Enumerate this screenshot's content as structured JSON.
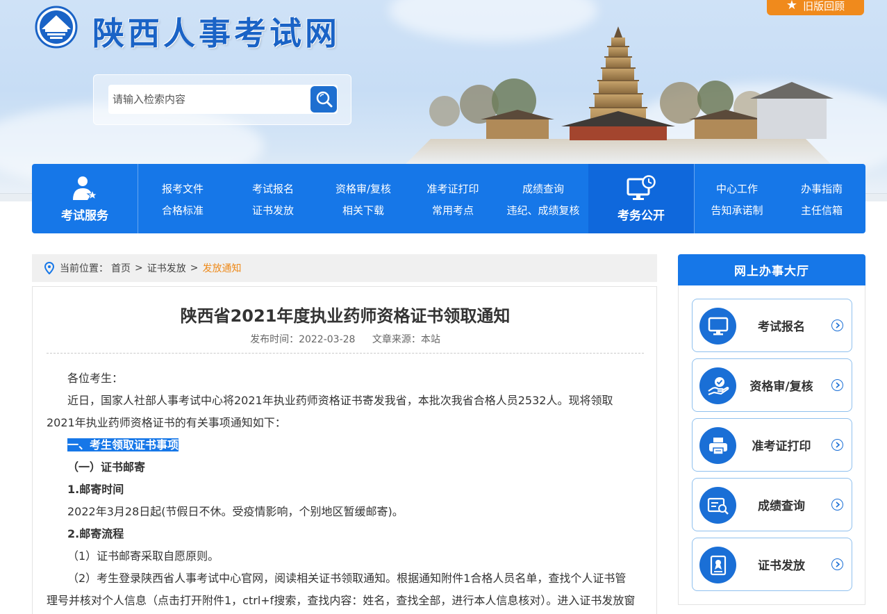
{
  "header": {
    "site_title": "陕西人事考试网",
    "old_version_label": "旧版回顾",
    "search_placeholder": "请输入检索内容"
  },
  "nav": {
    "exam_service_label": "考试服务",
    "exam_public_label": "考务公开",
    "links_row1": [
      "报考文件",
      "考试报名",
      "资格审/复核",
      "准考证打印",
      "成绩查询"
    ],
    "links_row2": [
      "合格标准",
      "证书发放",
      "相关下载",
      "常用考点",
      "违纪、成绩复核"
    ],
    "right_row1": [
      "中心工作",
      "办事指南"
    ],
    "right_row2": [
      "告知承诺制",
      "主任信箱"
    ]
  },
  "breadcrumb": {
    "prefix": "当前位置：",
    "home": "首页",
    "section": "证书发放",
    "current": "发放通知",
    "separator": ">"
  },
  "article": {
    "title": "陕西省2021年度执业药师资格证书领取通知",
    "publish_time": "发布时间：2022-03-28",
    "source": "文章来源：本站",
    "paragraphs": [
      "各位考生：",
      "近日，国家人社部人事考试中心将2021年执业药师资格证书寄发我省，本批次我省合格人员2532人。现将领取2021年执业药师资格证书的有关事项通知如下：",
      "一、考生领取证书事项",
      "（一）证书邮寄",
      "1.邮寄时间",
      "2022年3月28日起(节假日不休。受疫情影响，个别地区暂缓邮寄)。",
      "2.邮寄流程",
      "（1）证书邮寄采取自愿原则。",
      "（2）考生登录陕西省人事考试中心官网，阅读相关证书领取通知。根据通知附件1合格人员名单，查找个人证书管理号并核对个人信息（点击打开附件1，ctrl+f搜索，查找内容：姓名，查找全部，进行本人信息核对）。进入证书发放窗"
    ]
  },
  "sidebar": {
    "title": "网上办事大厅",
    "items": [
      {
        "label": "考试报名",
        "icon": "monitor-icon"
      },
      {
        "label": "资格审/复核",
        "icon": "hand-check-icon"
      },
      {
        "label": "准考证打印",
        "icon": "printer-icon"
      },
      {
        "label": "成绩查询",
        "icon": "search-doc-icon"
      },
      {
        "label": "证书发放",
        "icon": "certificate-icon"
      }
    ]
  },
  "colors": {
    "primary_blue": "#1677e8",
    "accent_orange": "#f08a1c",
    "title_blue": "#1a63c6"
  }
}
